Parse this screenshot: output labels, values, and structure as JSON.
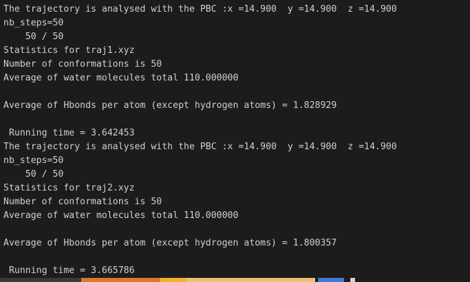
{
  "terminal": {
    "lines": [
      "The trajectory is analysed with the PBC :x =14.900  y =14.900  z =14.900",
      "nb_steps=50",
      "    50 / 50",
      "Statistics for traj1.xyz",
      "Number of conformations is 50",
      "Average of water molecules total 110.000000",
      "",
      "Average of Hbonds per atom (except hydrogen atoms) = 1.828929",
      "",
      " Running time = 3.642453",
      "The trajectory is analysed with the PBC :x =14.900  y =14.900  z =14.900",
      "nb_steps=50",
      "    50 / 50",
      "Statistics for traj2.xyz",
      "Number of conformations is 50",
      "Average of water molecules total 110.000000",
      "",
      "Average of Hbonds per atom (except hydrogen atoms) = 1.800357",
      "",
      " Running time = 3.665786"
    ]
  },
  "colors": {
    "background": "#1c1c1c",
    "text": "#d0d0d0",
    "status_seg_orange": "#d97a2b",
    "status_seg_yellow": "#f0b429",
    "status_seg_blue": "#3a7bd5"
  }
}
